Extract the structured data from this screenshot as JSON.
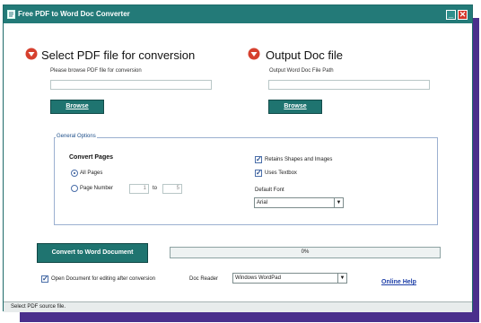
{
  "window": {
    "title": "Free PDF to Word Doc Converter",
    "minimize": "_",
    "close": "✕"
  },
  "source": {
    "heading": "Select PDF file for conversion",
    "hint": "Please browse PDF file for conversion",
    "path_value": "",
    "browse_label": "Browse"
  },
  "output": {
    "heading": "Output Doc file",
    "hint": "Output Word Doc File Path",
    "path_value": "",
    "browse_label": "Browse"
  },
  "options": {
    "legend": "General Options",
    "convert_pages": "Convert Pages",
    "all_pages": "All Pages",
    "page_number": "Page Number",
    "from_value": "1",
    "to_label": "to",
    "to_value": "5",
    "retain_shapes": "Retains Shapes and Images",
    "uses_textbox": "Uses Textbox",
    "default_font_label": "Default Font",
    "default_font_value": "Arial"
  },
  "actions": {
    "convert_label": "Convert to Word Document",
    "progress_text": "0%",
    "progress_value": 0,
    "open_doc_label": "Open Document for editing after conversion",
    "doc_reader_label": "Doc Reader",
    "doc_reader_value": "Windows WordPad",
    "online_help": "Online Help"
  },
  "status": {
    "text": "Select PDF source file."
  },
  "colors": {
    "titlebar": "#237a78",
    "button": "#1f7470",
    "accent_shadow": "#4a2f8c",
    "arrow_icon": "#d6402e"
  }
}
